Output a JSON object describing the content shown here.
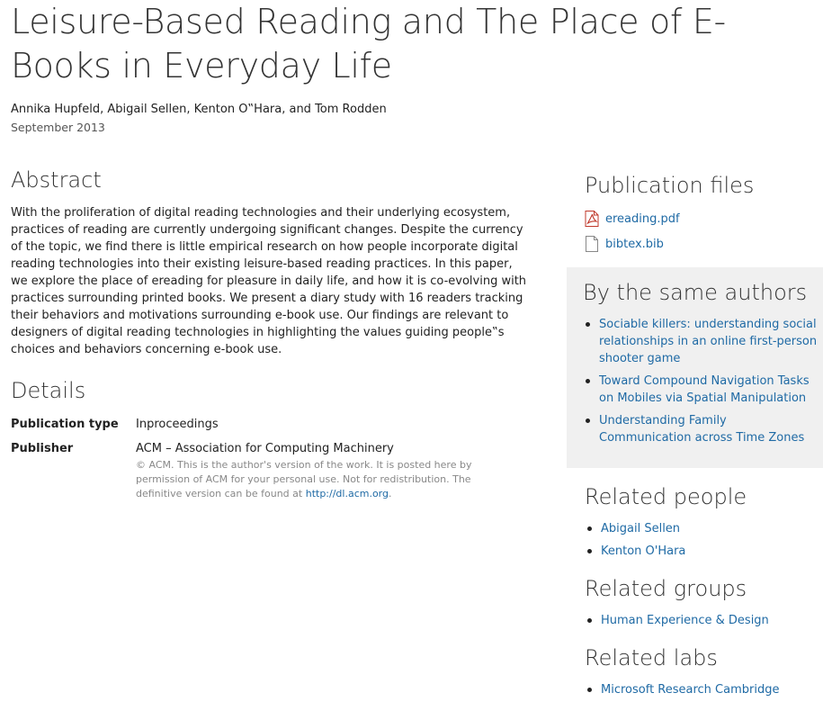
{
  "publication": {
    "title": "Leisure-Based Reading and The Place of E-Books in Everyday Life",
    "authors": "Annika Hupfeld, Abigail Sellen, Kenton O‟Hara, and Tom Rodden",
    "date": "September 2013"
  },
  "abstract": {
    "heading": "Abstract",
    "text": "With the proliferation of digital reading technologies and their underlying ecosystem, practices of reading are currently undergoing significant changes. Despite the currency of the topic, we find there is little empirical research on how people incorporate digital reading technologies into their existing leisure-based reading practices. In this paper, we explore the place of ereading for pleasure in daily life, and how it is co-evolving with practices surrounding printed books. We present a diary study with 16 readers tracking their behaviors and motivations surrounding e-book use. Our findings are relevant to designers of digital reading technologies in highlighting the values guiding people‟s choices and behaviors concerning e-book use."
  },
  "details": {
    "heading": "Details",
    "publication_type_label": "Publication type",
    "publication_type_value": "Inproceedings",
    "publisher_label": "Publisher",
    "publisher_value": "ACM – Association for Computing Machinery",
    "publisher_note": "© ACM. This is the author's version of the work. It is posted here by permission of ACM for your personal use. Not for redistribution. The definitive version can be found at ",
    "publisher_link": "http://dl.acm.org",
    "publisher_note_end": "."
  },
  "files": {
    "heading": "Publication files",
    "items": [
      {
        "name": "ereading.pdf",
        "icon": "pdf-file-icon"
      },
      {
        "name": "bibtex.bib",
        "icon": "document-file-icon"
      }
    ]
  },
  "same_authors": {
    "heading": "By the same authors",
    "items": [
      "Sociable killers: understanding social relationships in an online first-person shooter game",
      "Toward Compound Navigation Tasks on Mobiles via Spatial Manipulation",
      "Understanding Family Communication across Time Zones"
    ]
  },
  "related_people": {
    "heading": "Related people",
    "items": [
      "Abigail Sellen",
      "Kenton O'Hara"
    ]
  },
  "related_groups": {
    "heading": "Related groups",
    "items": [
      "Human Experience & Design"
    ]
  },
  "related_labs": {
    "heading": "Related labs",
    "items": [
      "Microsoft Research Cambridge"
    ]
  },
  "colors": {
    "link": "#1f6aa5",
    "sidebar_box": "#f0f0f0",
    "pdf_icon": "#c0392b"
  }
}
